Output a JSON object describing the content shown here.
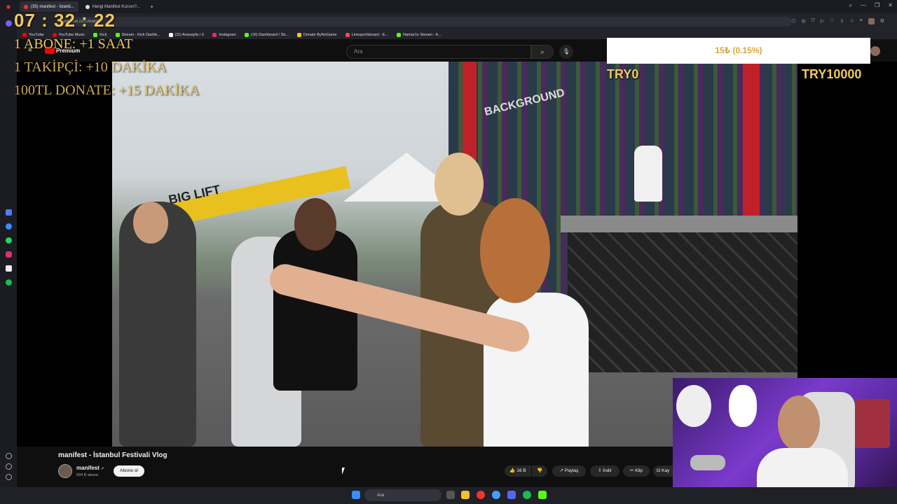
{
  "browser": {
    "tabs": [
      {
        "label": "(35) manifest - İstanb..."
      },
      {
        "label": "Hangi Manifest Kızısın?..."
      }
    ],
    "url": "youtube.com/watch",
    "bookmarks": [
      {
        "label": "YouTube",
        "color": "#ff0000"
      },
      {
        "label": "YouTube Music",
        "color": "#ff0000"
      },
      {
        "label": "Kick",
        "color": "#53fc18"
      },
      {
        "label": "Stream - Kick Dashb...",
        "color": "#53fc18"
      },
      {
        "label": "(11) Anasayfa / X",
        "color": "#ffffff"
      },
      {
        "label": "Instagram",
        "color": "#e1306c"
      },
      {
        "label": "(16) Dashboard / Str...",
        "color": "#53fc18"
      },
      {
        "label": "Donate ByNoGame",
        "color": "#ffcc00"
      },
      {
        "label": "LineupsValorant - E...",
        "color": "#ff4655"
      },
      {
        "label": "Namar1e Stream - K...",
        "color": "#53fc18"
      }
    ]
  },
  "youtube": {
    "logo_text": "Premium",
    "search_placeholder": "Ara",
    "video_title": "manifest - İstanbul Festivali Vlog",
    "channel_name": "manifest",
    "channel_subs": "694 B abone",
    "subscribe_label": "Abone ol",
    "like_count": "16 B",
    "share_label": "Paylaş",
    "download_label": "İndir",
    "clip_label": "Klip",
    "save_label": "Kay"
  },
  "overlay": {
    "timer": "07 : 32 : 22",
    "rules": [
      "1 ABONE: +1 SAAT",
      "1 TAKİPÇİ: +10 DAKİKA",
      "100TL DONATE: +15 DAKİKA"
    ],
    "goal_text": "15₺ (0.15%)",
    "goal_min": "TRY0",
    "goal_max": "TRY10000"
  },
  "video_scene": {
    "stage_sign": "BACKGROUND",
    "lift_sign": "BIG LIFT"
  },
  "taskbar": {
    "search_placeholder": "Ara"
  },
  "colors": {
    "overlay_gold": "#f0c85a",
    "yt_bg": "#0f0f0f",
    "accent_red": "#ff0000"
  }
}
